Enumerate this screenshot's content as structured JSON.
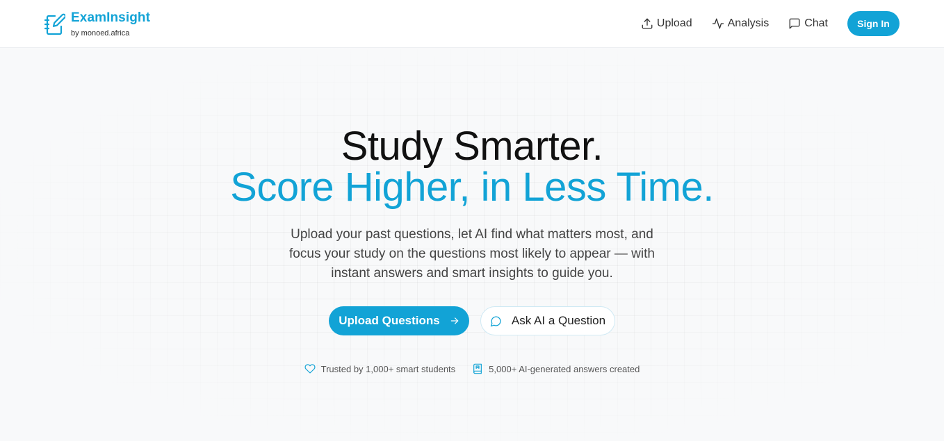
{
  "brand": {
    "name": "ExamInsight",
    "subtitle": "by monoed.africa",
    "logo_icon": "notebook-pen-icon"
  },
  "nav": {
    "items": [
      {
        "label": "Upload",
        "icon": "upload-icon"
      },
      {
        "label": "Analysis",
        "icon": "activity-icon"
      },
      {
        "label": "Chat",
        "icon": "message-square-icon"
      }
    ],
    "signin_label": "Sign In"
  },
  "hero": {
    "title_line1": "Study Smarter.",
    "title_line2": "Score Higher, in Less Time.",
    "subtitle": "Upload your past questions, let AI find what matters most, and focus your study on the questions most likely to appear — with instant answers and smart insights to guide you.",
    "primary_cta": "Upload Questions",
    "secondary_cta": "Ask AI a Question"
  },
  "stats": [
    {
      "label": "Trusted by 1,000+ smart students",
      "icon": "heart-icon"
    },
    {
      "label": "5,000+ AI-generated answers created",
      "icon": "book-icon"
    }
  ],
  "colors": {
    "accent": "#12a3d6",
    "background": "#f8f9fa",
    "text": "#111111"
  }
}
